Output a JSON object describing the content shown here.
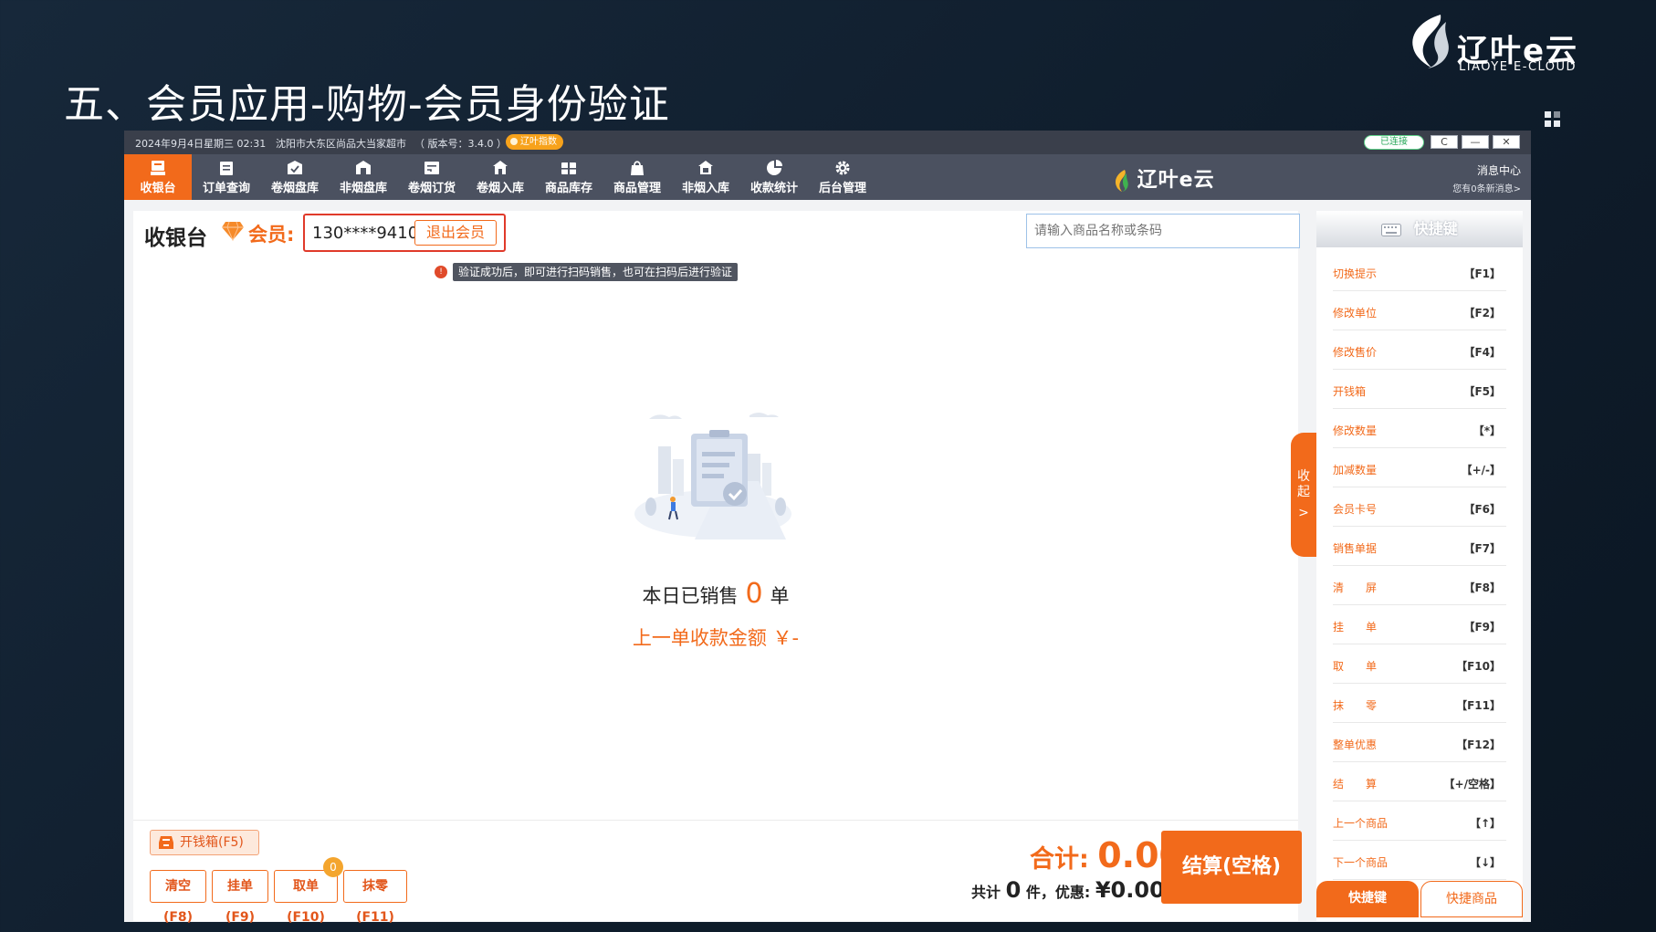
{
  "slide": {
    "title": "五、会员应用-购物-会员身份验证",
    "brand_cn": "辽叶e云",
    "brand_en": "LIAOYE E-CLOUD"
  },
  "titlebar": {
    "datetime": "2024年9月4日星期三 02:31",
    "store": "沈阳市大东区尚品大当家超市",
    "version": "（ 版本号：3.4.0 ）",
    "badge": "辽叶指数",
    "connection": "已连接",
    "btn_refresh": "C",
    "btn_min": "—",
    "btn_close": "✕"
  },
  "nav": {
    "items": [
      {
        "label": "收银台",
        "icon": "cashier-icon"
      },
      {
        "label": "订单查询",
        "icon": "order-search-icon"
      },
      {
        "label": "卷烟盘库",
        "icon": "cigarette-inventory-icon"
      },
      {
        "label": "非烟盘库",
        "icon": "non-cigarette-inventory-icon"
      },
      {
        "label": "卷烟订货",
        "icon": "cigarette-order-icon"
      },
      {
        "label": "卷烟入库",
        "icon": "cigarette-stock-in-icon"
      },
      {
        "label": "商品库存",
        "icon": "product-stock-icon"
      },
      {
        "label": "商品管理",
        "icon": "product-manage-icon"
      },
      {
        "label": "非烟入库",
        "icon": "non-cigarette-stock-in-icon"
      },
      {
        "label": "收款统计",
        "icon": "payment-stats-icon"
      },
      {
        "label": "后台管理",
        "icon": "gear-icon"
      }
    ],
    "brand": "辽叶e云",
    "message_center": "消息中心",
    "message_sub": "您有0条新消息>"
  },
  "main": {
    "title": "收银台",
    "member_label": "会员:",
    "member_phone": "130****9410",
    "exit_member": "退出会员",
    "tip_icon": "!",
    "tip": "验证成功后，即可进行扫码销售，也可在扫码后进行验证",
    "search_placeholder": "请输入商品名称或条码",
    "today_prefix": "本日已销售",
    "today_count": "0",
    "today_suffix": "单",
    "last_amount": "上一单收款金额 ￥-",
    "collapse_tab": "收起",
    "collapse_arrow": ">"
  },
  "bottom": {
    "cash_drawer": "开钱箱(F5)",
    "clear": "清空(F8)",
    "hold": "挂单(F9)",
    "retrieve": "取单(F10)",
    "round": "抹零(F11)",
    "held_count": "0",
    "total_label": "合计:",
    "total_amount": "0.00",
    "summary_prefix": "共计",
    "item_count": "0",
    "summary_mid": "件，优惠:",
    "discount": "¥0.00",
    "checkout": "结算(空格)"
  },
  "shortcuts": {
    "header": "快捷键",
    "items": [
      {
        "name": "切换提示",
        "key": "【F1】"
      },
      {
        "name": "修改单位",
        "key": "【F2】"
      },
      {
        "name": "修改售价",
        "key": "【F4】"
      },
      {
        "name": "开钱箱",
        "key": "【F5】"
      },
      {
        "name": "修改数量",
        "key": "【*】"
      },
      {
        "name": "加减数量",
        "key": "【+/-】"
      },
      {
        "name": "会员卡号",
        "key": "【F6】"
      },
      {
        "name": "销售单据",
        "key": "【F7】"
      },
      {
        "name": "清　　屏",
        "key": "【F8】"
      },
      {
        "name": "挂　　单",
        "key": "【F9】"
      },
      {
        "name": "取　　单",
        "key": "【F10】"
      },
      {
        "name": "抹　　零",
        "key": "【F11】"
      },
      {
        "name": "整单优惠",
        "key": "【F12】"
      },
      {
        "name": "结　　算",
        "key": "【+/空格】"
      },
      {
        "name": "上一个商品",
        "key": "【↑】"
      },
      {
        "name": "下一个商品",
        "key": "【↓】"
      }
    ],
    "tab_active": "快捷键",
    "tab_inactive": "快捷商品"
  },
  "colors": {
    "accent": "#f26a1b",
    "navbar": "#4b5160",
    "titlebar": "#3a3f4b",
    "slide_bg": "#142436",
    "alert": "#e03a2a"
  }
}
